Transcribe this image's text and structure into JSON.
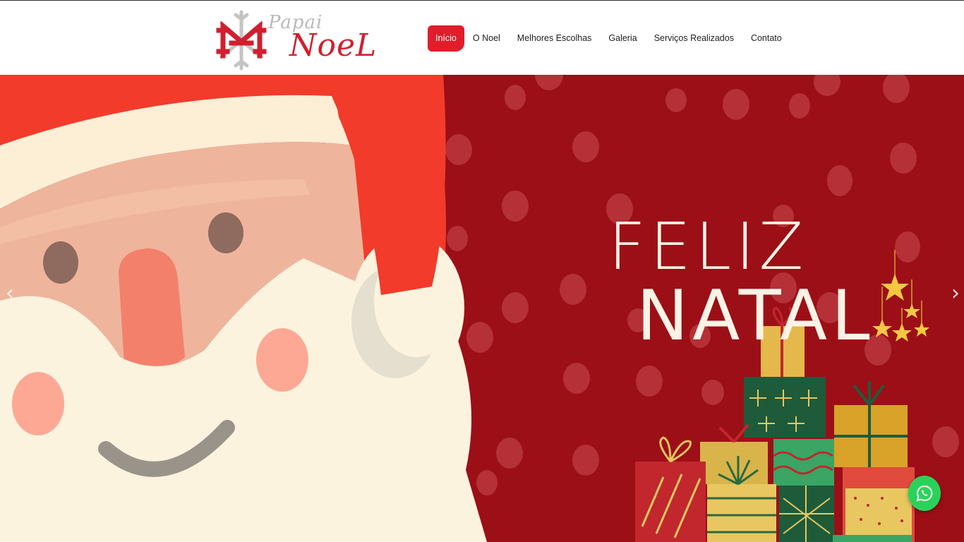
{
  "brand": {
    "line1": "Papai",
    "line2": "NoeL",
    "colors": {
      "red": "#d11f2f",
      "grey": "#b9b9b9"
    }
  },
  "nav": {
    "items": [
      {
        "label": "Início",
        "active": true
      },
      {
        "label": "O Noel",
        "active": false
      },
      {
        "label": "Melhores Escolhas",
        "active": false
      },
      {
        "label": "Galeria",
        "active": false
      },
      {
        "label": "Serviços Realizados",
        "active": false
      },
      {
        "label": "Contato",
        "active": false
      }
    ],
    "active_color": "#e11d2a"
  },
  "hero": {
    "line1": "FELIZ",
    "line2": "NATAL",
    "background": "#9c0f17",
    "prev_icon": "chevron-left-icon",
    "next_icon": "chevron-right-icon"
  },
  "floating": {
    "icon": "whatsapp-icon",
    "color": "#2bd25a"
  }
}
